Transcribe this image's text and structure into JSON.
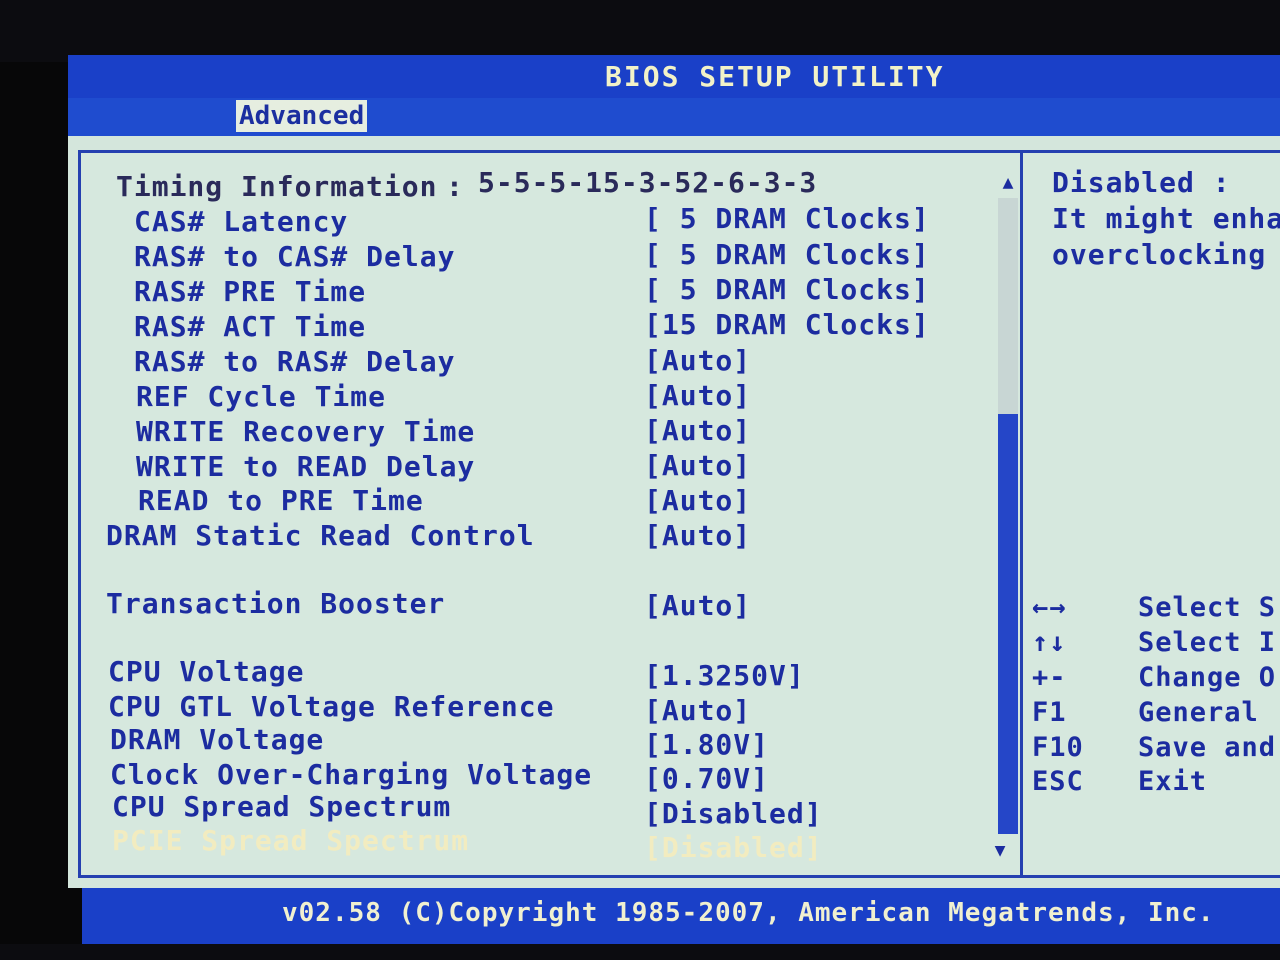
{
  "title": "BIOS SETUP UTILITY",
  "tabs": [
    {
      "label": "Advanced",
      "selected": true
    }
  ],
  "timing_info": {
    "label": "Timing Information",
    "separator": ":",
    "value": "5-5-5-15-3-52-6-3-3"
  },
  "settings": [
    {
      "label": "CAS# Latency",
      "value": "[ 5 DRAM Clocks]"
    },
    {
      "label": "RAS# to CAS# Delay",
      "value": "[ 5 DRAM Clocks]"
    },
    {
      "label": "RAS# PRE Time",
      "value": "[ 5 DRAM Clocks]"
    },
    {
      "label": "RAS# ACT Time",
      "value": "[15 DRAM Clocks]"
    },
    {
      "label": "RAS# to RAS# Delay",
      "value": "[Auto]"
    },
    {
      "label": "REF Cycle Time",
      "value": "[Auto]"
    },
    {
      "label": "WRITE Recovery Time",
      "value": "[Auto]"
    },
    {
      "label": "WRITE to READ Delay",
      "value": "[Auto]"
    },
    {
      "label": "READ to PRE Time",
      "value": "[Auto]"
    },
    {
      "label": "DRAM Static Read Control",
      "value": "[Auto]"
    },
    {
      "label": "Transaction Booster",
      "value": "[Auto]"
    },
    {
      "label": "CPU Voltage",
      "value": "[1.3250V]"
    },
    {
      "label": "CPU GTL Voltage Reference",
      "value": "[Auto]"
    },
    {
      "label": "DRAM Voltage",
      "value": "[1.80V]"
    },
    {
      "label": "Clock Over-Charging Voltage",
      "value": "[0.70V]"
    },
    {
      "label": "CPU Spread Spectrum",
      "value": "[Disabled]"
    },
    {
      "label": "PCIE Spread Spectrum",
      "value": "[Disabled]",
      "highlighted": true
    }
  ],
  "scroll": {
    "up_arrow": "▲",
    "down_arrow": "▼"
  },
  "help": {
    "lines": [
      "Disabled :",
      "It might enha",
      "overclocking"
    ]
  },
  "keys": [
    {
      "key": "←→",
      "desc": "Select S"
    },
    {
      "key": "↑↓",
      "desc": "Select I"
    },
    {
      "key": "+-",
      "desc": "Change O"
    },
    {
      "key": "F1",
      "desc": "General"
    },
    {
      "key": "F10",
      "desc": "Save and"
    },
    {
      "key": "ESC",
      "desc": "Exit"
    }
  ],
  "footer": "v02.58 (C)Copyright 1985-2007, American Megatrends, Inc.",
  "colors": {
    "bar_blue": "#1a40c8",
    "panel_bg": "#d6e8de",
    "text_blue": "#1c2ca0",
    "highlight": "#f2ecc0"
  }
}
